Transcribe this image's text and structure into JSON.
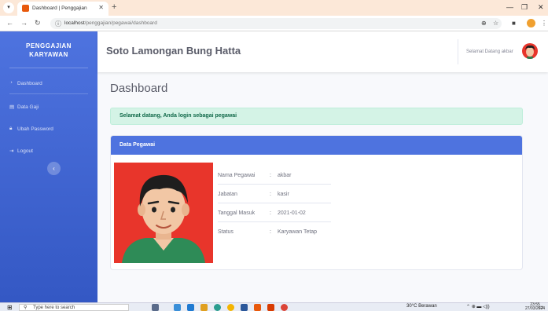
{
  "browser": {
    "tab_title": "Dashboard | Penggajian",
    "url_host": "localhost",
    "url_path": "/penggajian/pegawai/dashboard"
  },
  "sidebar": {
    "brand_line1": "PENGGAJIAN",
    "brand_line2": "KARYAWAN",
    "items": [
      {
        "label": "Dashboard",
        "icon": "gauge-icon"
      },
      {
        "label": "Data Gaji",
        "icon": "money-icon"
      },
      {
        "label": "Ubah Password",
        "icon": "lock-icon"
      },
      {
        "label": "Logout",
        "icon": "logout-icon"
      }
    ]
  },
  "topbar": {
    "title": "Soto Lamongan Bung Hatta",
    "welcome": "Selamat Datang akbar"
  },
  "main": {
    "page_title": "Dashboard",
    "alert": "Selamat datang, Anda login sebagai pegawai",
    "card_title": "Data Pegawai",
    "rows": [
      {
        "label": "Nama Pegawai",
        "value": "akbar"
      },
      {
        "label": "Jabatan",
        "value": "kasir"
      },
      {
        "label": "Tanggal Masuk",
        "value": "2021-01-02"
      },
      {
        "label": "Status",
        "value": "Karyawan Tetap"
      }
    ]
  },
  "taskbar": {
    "search_placeholder": "Type here to search",
    "weather": "30°C  Berawan",
    "time": "23:55",
    "date": "27/03/2024"
  },
  "colors": {
    "primary": "#4e73df",
    "alert_bg": "#d4f3e6",
    "alert_text": "#0f6848",
    "photo_bg": "#e8352b"
  }
}
